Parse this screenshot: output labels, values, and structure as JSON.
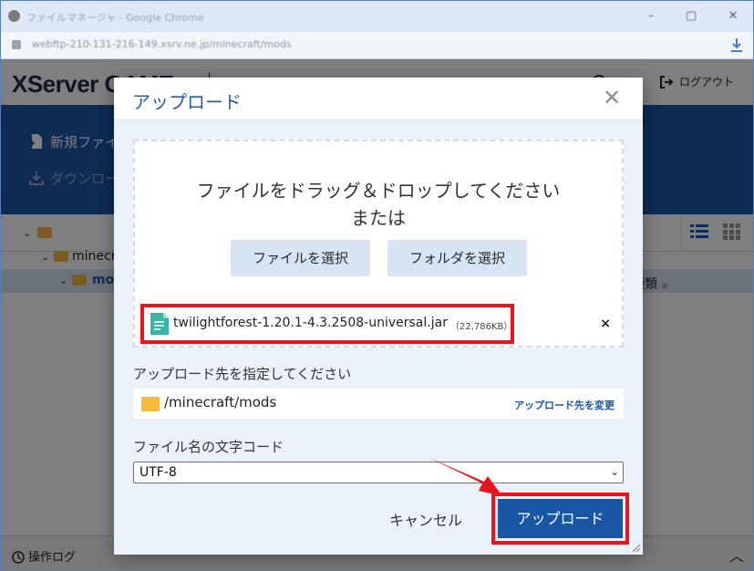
{
  "browser": {
    "window_title": "ファイルマネージャ - Google Chrome",
    "url": "webftp-210-131-216-149.xsrv.ne.jp/minecraft/mods"
  },
  "app": {
    "logo_main": "XServer",
    "logo_sub": "GAME",
    "logout_label": "ログアウト",
    "toolbar": {
      "new_file": "新規ファイル",
      "download": "ダウンロード"
    },
    "tree": {
      "row1": "minecraft",
      "row2": "mods"
    },
    "sort_label": "種類",
    "operation_log": "操作ログ"
  },
  "modal": {
    "title": "アップロード",
    "dropzone": {
      "line1": "ファイルをドラッグ＆ドロップしてください",
      "line2": "または",
      "select_file": "ファイルを選択",
      "select_folder": "フォルダを選択"
    },
    "file": {
      "name": "twilightforest-1.20.1-4.3.2508-universal.jar",
      "size": "（22,786KB）",
      "remove": "×"
    },
    "destination": {
      "label": "アップロード先を指定してください",
      "path": "/minecraft/mods",
      "change": "アップロード先を変更"
    },
    "encoding": {
      "label": "ファイル名の文字コード",
      "value": "UTF-8",
      "options": [
        "UTF-8"
      ]
    },
    "cancel_label": "キャンセル",
    "upload_label": "アップロード"
  },
  "colors": {
    "brand_blue": "#1a56a6",
    "highlight_red": "#e8141e",
    "modal_bg": "#eaf1f9",
    "folder": "#f6b93b"
  }
}
